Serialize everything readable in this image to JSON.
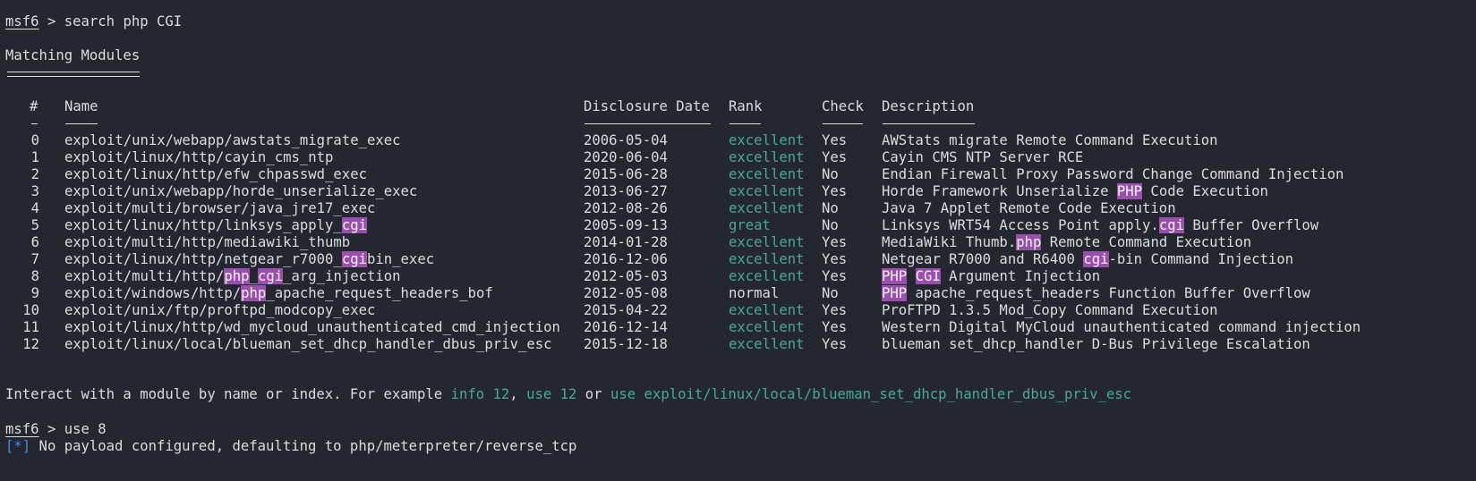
{
  "prompt1": {
    "prompt": "msf6",
    "sep": " > ",
    "command": "search php CGI"
  },
  "heading": "Matching Modules",
  "columns": {
    "num": "#",
    "name": "Name",
    "date": "Disclosure Date",
    "rank": "Rank",
    "check": "Check",
    "desc": "Description"
  },
  "rows": [
    {
      "num": "0",
      "name": [
        {
          "t": "exploit/unix/webapp/awstats_migrate_exec"
        }
      ],
      "date": "2006-05-04",
      "rank": "excellent",
      "check": "Yes",
      "desc": [
        {
          "t": "AWStats migrate Remote Command Execution"
        }
      ]
    },
    {
      "num": "1",
      "name": [
        {
          "t": "exploit/linux/http/cayin_cms_ntp"
        }
      ],
      "date": "2020-06-04",
      "rank": "excellent",
      "check": "Yes",
      "desc": [
        {
          "t": "Cayin CMS NTP Server RCE"
        }
      ]
    },
    {
      "num": "2",
      "name": [
        {
          "t": "exploit/linux/http/efw_chpasswd_exec"
        }
      ],
      "date": "2015-06-28",
      "rank": "excellent",
      "check": "No",
      "desc": [
        {
          "t": "Endian Firewall Proxy Password Change Command Injection"
        }
      ]
    },
    {
      "num": "3",
      "name": [
        {
          "t": "exploit/unix/webapp/horde_unserialize_exec"
        }
      ],
      "date": "2013-06-27",
      "rank": "excellent",
      "check": "Yes",
      "desc": [
        {
          "t": "Horde Framework Unserialize "
        },
        {
          "t": "PHP",
          "hl": true
        },
        {
          "t": " Code Execution"
        }
      ]
    },
    {
      "num": "4",
      "name": [
        {
          "t": "exploit/multi/browser/java_jre17_exec"
        }
      ],
      "date": "2012-08-26",
      "rank": "excellent",
      "check": "No",
      "desc": [
        {
          "t": "Java 7 Applet Remote Code Execution"
        }
      ]
    },
    {
      "num": "5",
      "name": [
        {
          "t": "exploit/linux/http/linksys_apply_"
        },
        {
          "t": "cgi",
          "hl": true
        }
      ],
      "date": "2005-09-13",
      "rank": "great",
      "check": "No",
      "desc": [
        {
          "t": "Linksys WRT54 Access Point apply."
        },
        {
          "t": "cgi",
          "hl": true
        },
        {
          "t": " Buffer Overflow"
        }
      ]
    },
    {
      "num": "6",
      "name": [
        {
          "t": "exploit/multi/http/mediawiki_thumb"
        }
      ],
      "date": "2014-01-28",
      "rank": "excellent",
      "check": "Yes",
      "desc": [
        {
          "t": "MediaWiki Thumb."
        },
        {
          "t": "php",
          "hl": true
        },
        {
          "t": " Remote Command Execution"
        }
      ]
    },
    {
      "num": "7",
      "name": [
        {
          "t": "exploit/linux/http/netgear_r7000_"
        },
        {
          "t": "cgi",
          "hl": true
        },
        {
          "t": "bin_exec"
        }
      ],
      "date": "2016-12-06",
      "rank": "excellent",
      "check": "Yes",
      "desc": [
        {
          "t": "Netgear R7000 and R6400 "
        },
        {
          "t": "cgi",
          "hl": true
        },
        {
          "t": "-bin Command Injection"
        }
      ]
    },
    {
      "num": "8",
      "name": [
        {
          "t": "exploit/multi/http/"
        },
        {
          "t": "php",
          "hl": true
        },
        {
          "t": "_"
        },
        {
          "t": "cgi",
          "hl": true
        },
        {
          "t": "_arg_injection"
        }
      ],
      "date": "2012-05-03",
      "rank": "excellent",
      "check": "Yes",
      "desc": [
        {
          "t": "PHP",
          "hl": true
        },
        {
          "t": " "
        },
        {
          "t": "CGI",
          "hl": true
        },
        {
          "t": " Argument Injection"
        }
      ]
    },
    {
      "num": "9",
      "name": [
        {
          "t": "exploit/windows/http/"
        },
        {
          "t": "php",
          "hl": true
        },
        {
          "t": "_apache_request_headers_bof"
        }
      ],
      "date": "2012-05-08",
      "rank": "normal",
      "check": "No",
      "desc": [
        {
          "t": "PHP",
          "hl": true
        },
        {
          "t": " apache_request_headers Function Buffer Overflow"
        }
      ]
    },
    {
      "num": "10",
      "name": [
        {
          "t": "exploit/unix/ftp/proftpd_modcopy_exec"
        }
      ],
      "date": "2015-04-22",
      "rank": "excellent",
      "check": "Yes",
      "desc": [
        {
          "t": "ProFTPD 1.3.5 Mod_Copy Command Execution"
        }
      ]
    },
    {
      "num": "11",
      "name": [
        {
          "t": "exploit/linux/http/wd_mycloud_unauthenticated_cmd_injection"
        }
      ],
      "date": "2016-12-14",
      "rank": "excellent",
      "check": "Yes",
      "desc": [
        {
          "t": "Western Digital MyCloud unauthenticated command injection"
        }
      ]
    },
    {
      "num": "12",
      "name": [
        {
          "t": "exploit/linux/local/blueman_set_dhcp_handler_dbus_priv_esc"
        }
      ],
      "date": "2015-12-18",
      "rank": "excellent",
      "check": "Yes",
      "desc": [
        {
          "t": "blueman set_dhcp_handler D-Bus Privilege Escalation"
        }
      ]
    }
  ],
  "interact": {
    "text": "Interact with a module by name or index. For example ",
    "ex1": "info 12",
    "comma": ", ",
    "ex2": "use 12",
    "or": " or ",
    "ex3": "use exploit/linux/local/blueman_set_dhcp_handler_dbus_priv_esc"
  },
  "prompt2": {
    "prompt": "msf6",
    "sep": " > ",
    "command": "use 8"
  },
  "status": {
    "marker": "[*]",
    "text": " No payload configured, defaulting to php/meterpreter/reverse_tcp"
  },
  "colors": {
    "background": "#252730",
    "rank_excellent": "#47a896",
    "highlight": "#9a4fae",
    "status_marker": "#3b8eea"
  }
}
